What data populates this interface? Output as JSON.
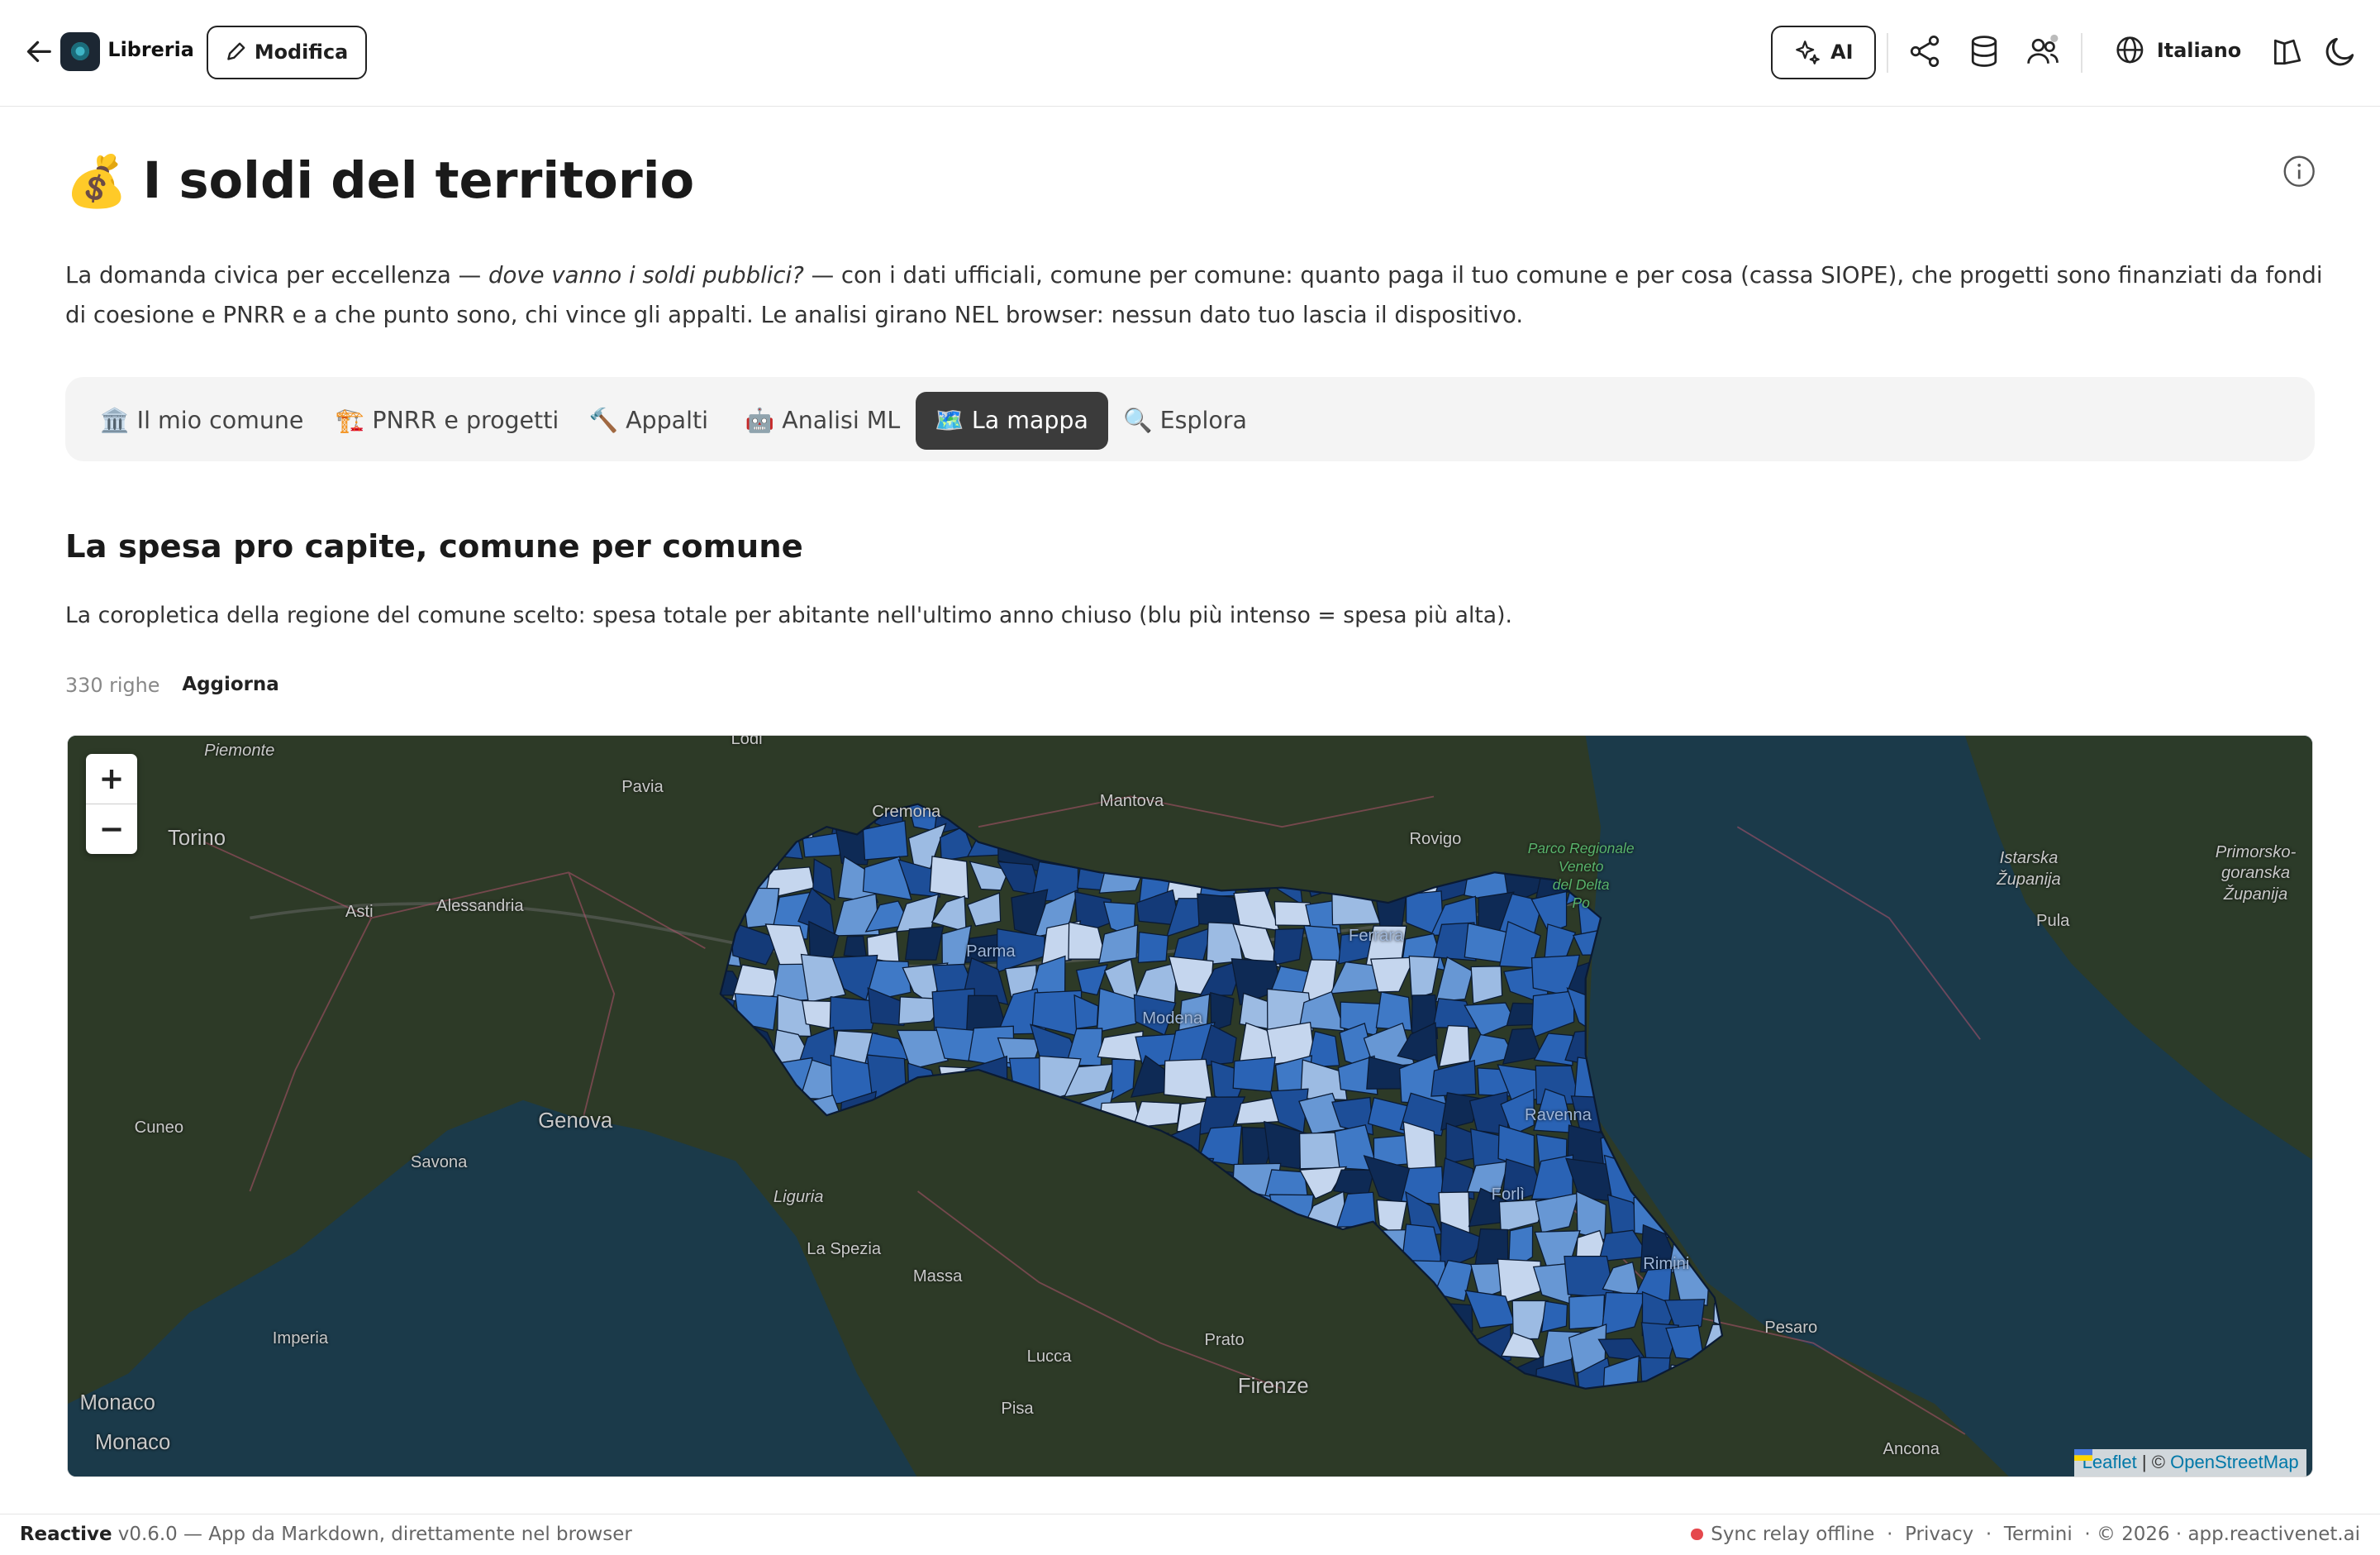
{
  "header": {
    "brand": "Libreria",
    "edit_label": "Modifica",
    "ai_label": "AI",
    "language": "Italiano"
  },
  "page": {
    "emoji": "💰",
    "title": "I soldi del territorio",
    "intro_a": "La domanda civica per eccellenza — ",
    "intro_em": "dove vanno i soldi pubblici?",
    "intro_b": " — con i dati ufficiali, comune per comune: quanto paga il tuo comune e per cosa (cassa SIOPE), che progetti sono finanziati da fondi di coesione e PNRR e a che punto sono, chi vince gli appalti. Le analisi girano NEL browser: nessun dato tuo lascia il dispositivo."
  },
  "tabs": [
    {
      "label": "🏛️ Il mio comune"
    },
    {
      "label": "🏗️ PNRR e progetti"
    },
    {
      "label": "🔨 Appalti"
    },
    {
      "label": "🤖 Analisi ML"
    },
    {
      "label": "🗺️ La mappa"
    },
    {
      "label": "🔍 Esplora"
    }
  ],
  "section": {
    "title": "La spesa pro capite, comune per comune",
    "description": "La coropletica della regione del comune scelto: spesa totale per abitante nell'ultimo anno chiuso (blu più intenso = spesa più alta).",
    "rows": "330 righe",
    "refresh": "Aggiorna"
  },
  "map": {
    "zoom_in": "+",
    "zoom_out": "−",
    "attribution_leaflet": "Leaflet",
    "attribution_sep": " | © ",
    "attribution_osm": "OpenStreetMap",
    "places": {
      "piemonte": "Piemonte",
      "torino": "Torino",
      "pavia": "Pavia",
      "cremona": "Cremona",
      "mantova": "Mantova",
      "rovigo": "Rovigo",
      "parco": "Parco Regionale\nVeneto\ndel Delta\nPo",
      "asti": "Asti",
      "alessandria": "Alessandria",
      "cuneo": "Cuneo",
      "genova": "Genova",
      "savona": "Savona",
      "liguria": "Liguria",
      "laspezia": "La Spezia",
      "massa": "Massa",
      "imperia": "Imperia",
      "lucca": "Lucca",
      "prato": "Prato",
      "firenze": "Firenze",
      "pisa": "Pisa",
      "monaco1": "Monaco",
      "monaco2": "Monaco",
      "pesaro": "Pesaro",
      "ancona": "Ancona",
      "pula": "Pula",
      "istarska": "Istarska\nŽupanija",
      "primorsko": "Primorsko-\ngoranska\nŽupanija",
      "lodi": "Lodi",
      "ferrara": "Ferrara",
      "ravenna": "Ravenna",
      "rimini": "Rimini",
      "forli": "Forlì",
      "modena": "Modena",
      "parma": "Parma"
    }
  },
  "footer": {
    "brand": "Reactive",
    "version": " v0.6.0 — App da Markdown, direttamente nel browser",
    "sync": "Sync relay offline",
    "privacy": "Privacy",
    "terms": "Termini",
    "copyright": "· © 2026 · app.reactivenet.ai",
    "sep": "·"
  },
  "colors": {
    "choropleth": [
      "#0e2a55",
      "#143a78",
      "#1d4e98",
      "#2a63b5",
      "#3f79c6",
      "#6797d4",
      "#9cbbe3",
      "#c5d6ee"
    ],
    "sea": "#1b3a4a",
    "land": "#2c3a28",
    "active_tab": "#3b3b3b"
  }
}
